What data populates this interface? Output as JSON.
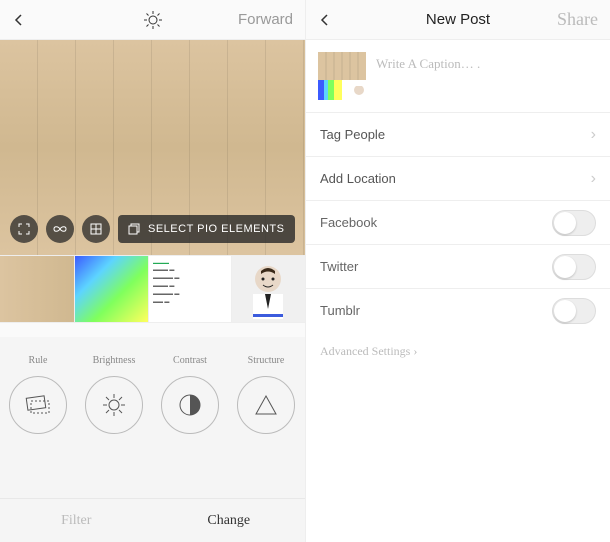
{
  "left": {
    "header": {
      "forward": "Forward"
    },
    "overlay": {
      "select": "SELECT PIO ELEMENTS"
    },
    "adjust": {
      "items": [
        {
          "label": "Rule"
        },
        {
          "label": "Brightness"
        },
        {
          "label": "Contrast"
        },
        {
          "label": "Structure"
        }
      ]
    },
    "tabs": {
      "filter": "Filter",
      "change": "Change"
    }
  },
  "right": {
    "header": {
      "title": "New Post",
      "share": "Share"
    },
    "caption_placeholder": "Write A Caption… .",
    "rows": {
      "tag": "Tag People",
      "location": "Add Location",
      "facebook": "Facebook",
      "twitter": "Twitter",
      "tumblr": "Tumblr"
    },
    "advanced": "Advanced Settings ›"
  }
}
